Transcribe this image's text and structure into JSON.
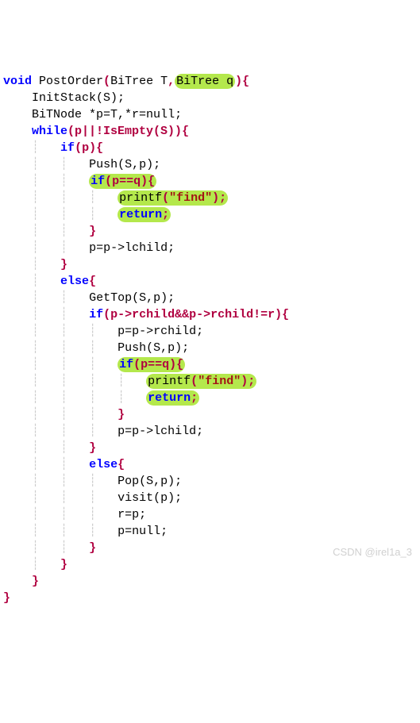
{
  "code": {
    "fn_sig_void": "void",
    "fn_name": "PostOrder",
    "fn_params_plain": "BiTree T",
    "fn_params_hl": "BiTree q",
    "l2": "InitStack(S);",
    "l3_type": "BiTNode",
    "l3_rest": "*p=T,*r=null;",
    "while_kw": "while",
    "while_cond": "(p||!IsEmpty(S))",
    "if_kw": "if",
    "if_p_cond": "(p)",
    "push_sp": "Push(S,p);",
    "if_peq_cond": "(p==q)",
    "printf_name": "printf",
    "printf_arg": "\"find\"",
    "return_kw": "return",
    "p_lchild": "p=p->lchild;",
    "else_kw": "else",
    "gettop": "GetTop(S,p);",
    "if_rchild_cond": "(p->rchild&&p->rchild!=r)",
    "p_rchild": "p=p->rchild;",
    "pop": "Pop(S,p);",
    "visit": "visit(p);",
    "r_eq_p": "r=p;",
    "p_null": "p=null;"
  },
  "watermark": "CSDN @irel1a_3"
}
